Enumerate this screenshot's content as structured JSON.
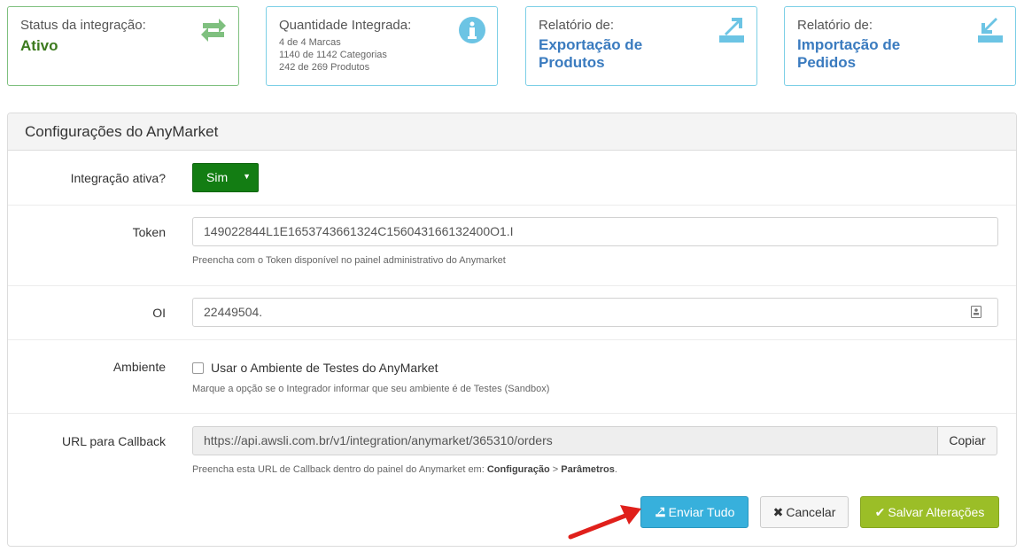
{
  "cards": [
    {
      "title": "Status da integração:",
      "value": "Ativo",
      "icon": "exchange-arrows-icon",
      "color": "#5cb85c"
    },
    {
      "title": "Quantidade Integrada:",
      "lines": [
        "4 de 4 Marcas",
        "1140 de 1142 Categorias",
        "242 de 269 Produtos"
      ],
      "icon": "info-circle-icon",
      "color": "#5bc0de"
    },
    {
      "title": "Relatório de:",
      "value_lines": [
        "Exportação de",
        "Produtos"
      ],
      "icon": "export-icon",
      "color": "#5bc0de"
    },
    {
      "title": "Relatório de:",
      "value_lines": [
        "Importação de",
        "Pedidos"
      ],
      "icon": "import-icon",
      "color": "#5bc0de"
    }
  ],
  "panel": {
    "title": "Configurações do AnyMarket",
    "fields": {
      "active": {
        "label": "Integração ativa?",
        "value": "Sim"
      },
      "token": {
        "label": "Token",
        "value": "149022844L1E1653743661324C156043166132400O1.I",
        "help": "Preencha com o Token disponível no painel administrativo do Anymarket"
      },
      "oi": {
        "label": "OI",
        "value": "22449504."
      },
      "env": {
        "label": "Ambiente",
        "checkbox_label": "Usar o Ambiente de Testes do AnyMarket",
        "checked": false,
        "help": "Marque a opção se o Integrador informar que seu ambiente é de Testes (Sandbox)"
      },
      "callback": {
        "label": "URL para Callback",
        "value": "https://api.awsli.com.br/v1/integration/anymarket/365310/orders",
        "copy_label": "Copiar",
        "help_prefix": "Preencha esta URL de Callback dentro do painel do Anymarket em: ",
        "help_b1": "Configuração",
        "help_sep": " > ",
        "help_b2": "Parâmetros",
        "help_suffix": "."
      }
    }
  },
  "buttons": {
    "send": "Enviar Tudo",
    "cancel": "Cancelar",
    "save": "Salvar Alterações"
  },
  "colors": {
    "accent_green": "#137d13",
    "btn_blue": "#37b0dc",
    "btn_olive": "#9bbe27",
    "annotation_arrow": "#e0201b"
  }
}
